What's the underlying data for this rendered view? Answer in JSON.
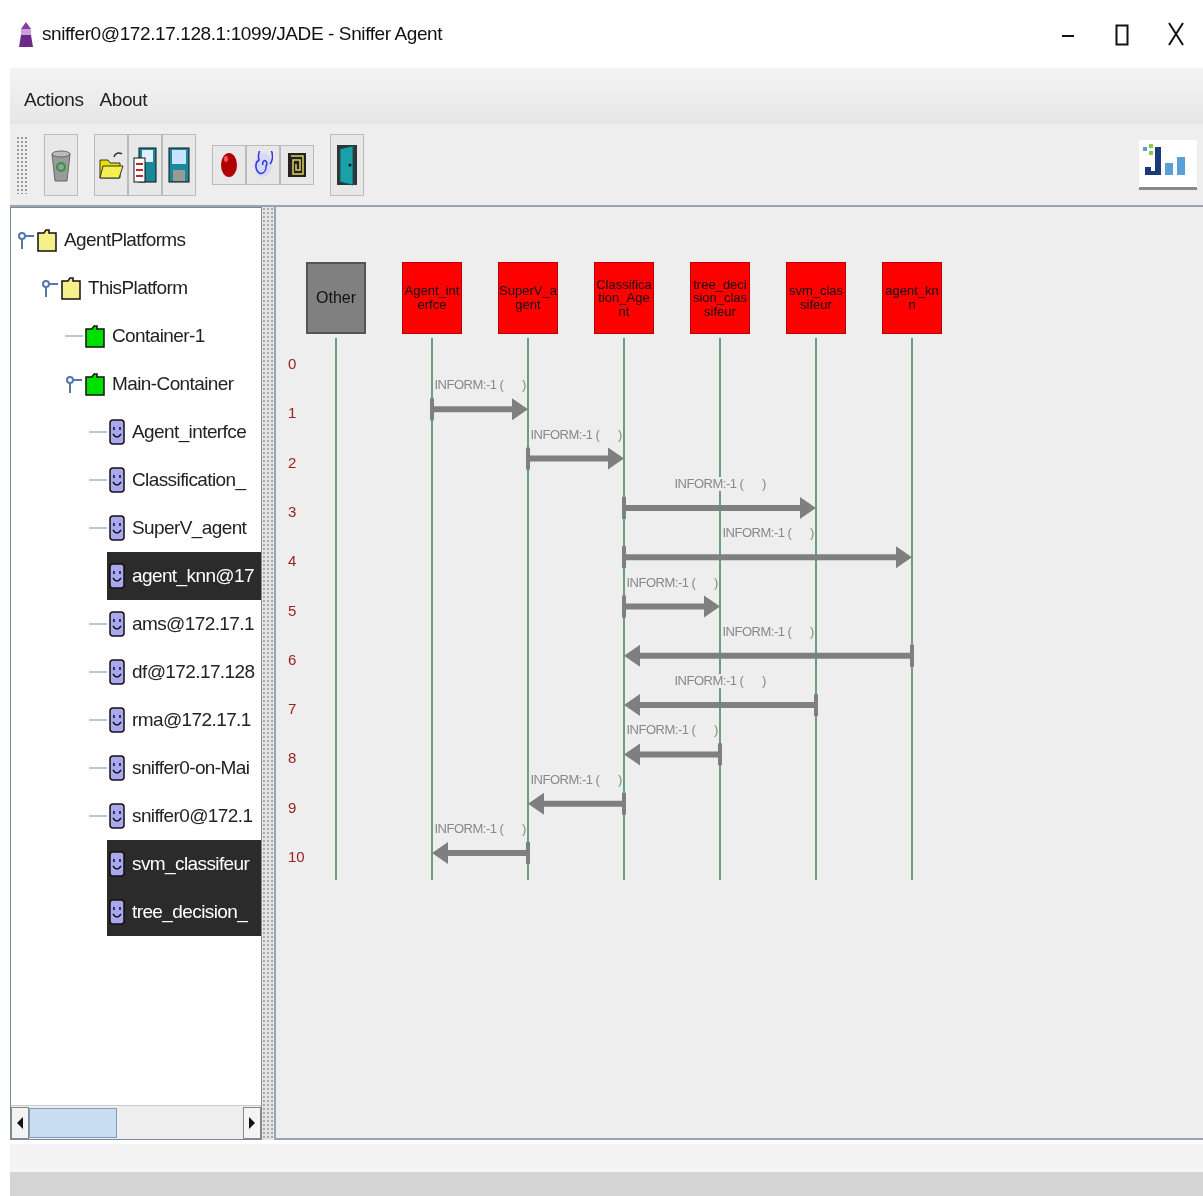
{
  "window": {
    "title": "sniffer0@172.17.128.1:1099/JADE - Sniffer Agent"
  },
  "menu": [
    "Actions",
    "About"
  ],
  "tree": [
    {
      "label": "AgentPlatforms",
      "kind": "platform",
      "children": [
        {
          "label": "ThisPlatform",
          "kind": "platform",
          "children": [
            {
              "label": "Container-1",
              "kind": "container"
            },
            {
              "label": "Main-Container",
              "kind": "container",
              "children": [
                {
                  "label": "Agent_interfce",
                  "kind": "agent",
                  "selected": false
                },
                {
                  "label": "Classification_",
                  "kind": "agent",
                  "selected": false
                },
                {
                  "label": "SuperV_agent",
                  "kind": "agent",
                  "selected": false
                },
                {
                  "label": "agent_knn@17",
                  "kind": "agent",
                  "selected": true
                },
                {
                  "label": "ams@172.17.1",
                  "kind": "agent",
                  "selected": false
                },
                {
                  "label": "df@172.17.128",
                  "kind": "agent",
                  "selected": false
                },
                {
                  "label": "rma@172.17.1",
                  "kind": "agent",
                  "selected": false
                },
                {
                  "label": "sniffer0-on-Mai",
                  "kind": "agent",
                  "selected": false
                },
                {
                  "label": "sniffer0@172.1",
                  "kind": "agent",
                  "selected": false
                },
                {
                  "label": "svm_classifeur",
                  "kind": "agent",
                  "selected": true
                },
                {
                  "label": "tree_decision_",
                  "kind": "agent",
                  "selected": true
                }
              ]
            }
          ]
        }
      ]
    }
  ],
  "diagram": {
    "agents": [
      {
        "name": "Other",
        "kind": "other"
      },
      {
        "name": "Agent_interfce",
        "kind": "sniffed"
      },
      {
        "name": "SuperV_agent",
        "kind": "sniffed"
      },
      {
        "name": "Classification_Agent",
        "kind": "sniffed"
      },
      {
        "name": "tree_decision_classifeur",
        "kind": "sniffed"
      },
      {
        "name": "svm_classifeur",
        "kind": "sniffed"
      },
      {
        "name": "agent_knn",
        "kind": "sniffed"
      }
    ],
    "rows": [
      {
        "number": "0"
      },
      {
        "number": "1",
        "message": {
          "label": "INFORM:-1 (      )",
          "lanes": [
            {
              "kind": "none"
            },
            {
              "kind": "tail"
            },
            {
              "kind": "head"
            },
            {
              "kind": "none"
            },
            {
              "kind": "none"
            },
            {
              "kind": "none"
            },
            {
              "kind": "none"
            }
          ]
        }
      },
      {
        "number": "2",
        "message": {
          "label": "INFORM:-1 (      )",
          "lanes": [
            {
              "kind": "none"
            },
            {
              "kind": "none"
            },
            {
              "kind": "tail"
            },
            {
              "kind": "head"
            },
            {
              "kind": "none"
            },
            {
              "kind": "none"
            },
            {
              "kind": "none"
            }
          ]
        }
      },
      {
        "number": "3",
        "message": {
          "label": "INFORM:-1 (      )",
          "lanes": [
            {
              "kind": "none"
            },
            {
              "kind": "none"
            },
            {
              "kind": "none"
            },
            {
              "kind": "tail"
            },
            {
              "kind": "none"
            },
            {
              "kind": "head"
            },
            {
              "kind": "none"
            }
          ]
        }
      },
      {
        "number": "4",
        "message": {
          "label": "INFORM:-1 (      )",
          "lanes": [
            {
              "kind": "none"
            },
            {
              "kind": "none"
            },
            {
              "kind": "none"
            },
            {
              "kind": "tail"
            },
            {
              "kind": "none"
            },
            {
              "kind": "none"
            },
            {
              "kind": "head"
            }
          ]
        }
      },
      {
        "number": "5",
        "message": {
          "label": "INFORM:-1 (      )",
          "lanes": [
            {
              "kind": "none"
            },
            {
              "kind": "none"
            },
            {
              "kind": "none"
            },
            {
              "kind": "tail"
            },
            {
              "kind": "head"
            },
            {
              "kind": "none"
            },
            {
              "kind": "none"
            }
          ]
        }
      },
      {
        "number": "6",
        "message": {
          "label": "INFORM:-1 (      )",
          "lanes": [
            {
              "kind": "none"
            },
            {
              "kind": "none"
            },
            {
              "kind": "none"
            },
            {
              "kind": "head"
            },
            {
              "kind": "none"
            },
            {
              "kind": "none"
            },
            {
              "kind": "tail"
            }
          ]
        }
      },
      {
        "number": "7",
        "message": {
          "label": "INFORM:-1 (      )",
          "lanes": [
            {
              "kind": "none"
            },
            {
              "kind": "none"
            },
            {
              "kind": "none"
            },
            {
              "kind": "head"
            },
            {
              "kind": "none"
            },
            {
              "kind": "tail"
            },
            {
              "kind": "none"
            }
          ]
        }
      },
      {
        "number": "8",
        "message": {
          "label": "INFORM:-1 (      )",
          "lanes": [
            {
              "kind": "none"
            },
            {
              "kind": "none"
            },
            {
              "kind": "none"
            },
            {
              "kind": "head"
            },
            {
              "kind": "tail"
            },
            {
              "kind": "none"
            },
            {
              "kind": "none"
            }
          ]
        }
      },
      {
        "number": "9",
        "message": {
          "label": "INFORM:-1 (      )",
          "lanes": [
            {
              "kind": "none"
            },
            {
              "kind": "none"
            },
            {
              "kind": "head"
            },
            {
              "kind": "tail"
            },
            {
              "kind": "none"
            },
            {
              "kind": "none"
            },
            {
              "kind": "none"
            }
          ]
        }
      },
      {
        "number": "10",
        "message": {
          "label": "INFORM:-1 (      )",
          "lanes": [
            {
              "kind": "none"
            },
            {
              "kind": "head"
            },
            {
              "kind": "tail"
            },
            {
              "kind": "none"
            },
            {
              "kind": "none"
            },
            {
              "kind": "none"
            },
            {
              "kind": "none"
            }
          ]
        }
      }
    ]
  }
}
